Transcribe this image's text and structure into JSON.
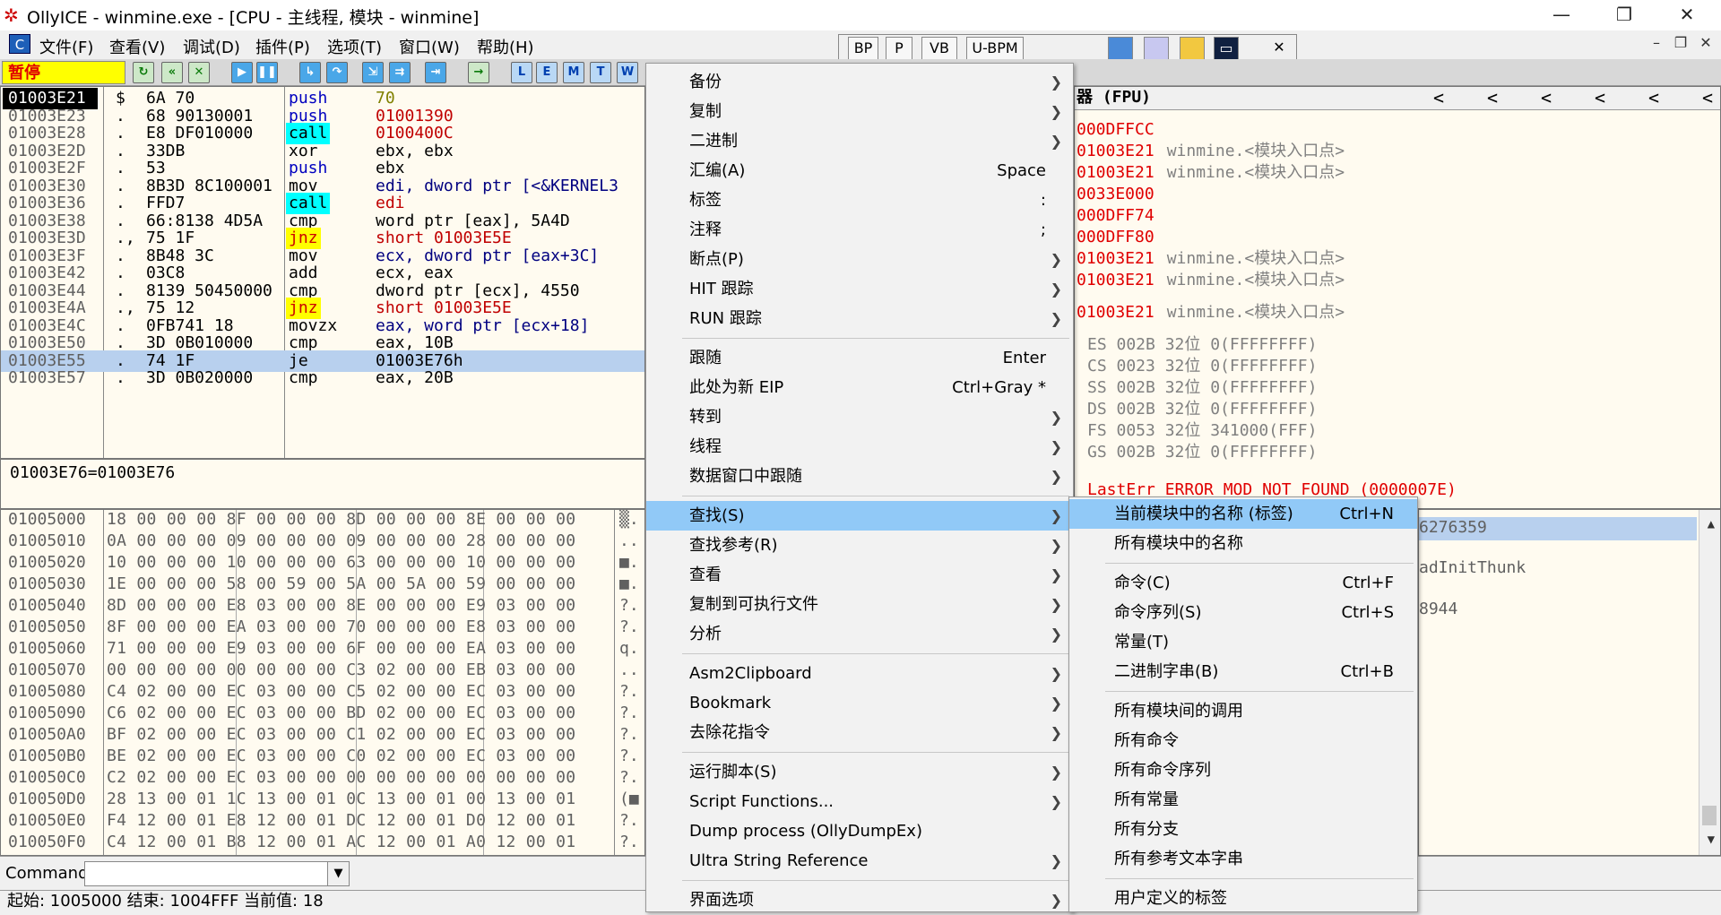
{
  "window": {
    "title": "OllyICE - winmine.exe - [CPU -  主线程, 模块 - winmine]"
  },
  "menubar": [
    "文件(F)",
    "查看(V)",
    "调试(D)",
    "插件(P)",
    "选项(T)",
    "窗口(W)",
    "帮助(H)"
  ],
  "toolbar_top": {
    "buttons": [
      "BP",
      "P",
      "VB",
      "U-BPM"
    ]
  },
  "toolbar": {
    "status": "暂停",
    "letters": [
      "L",
      "E",
      "M",
      "T",
      "W"
    ]
  },
  "disasm": {
    "rows": [
      {
        "addr": "01003E21",
        "flag": "$",
        "hex": "6A 70",
        "op": "push",
        "arg": "70"
      },
      {
        "addr": "01003E23",
        "flag": ".",
        "hex": "68 90130001",
        "op": "push",
        "arg": "01001390"
      },
      {
        "addr": "01003E28",
        "flag": ".",
        "hex": "E8 DF010000",
        "op": "call",
        "arg": "0100400C"
      },
      {
        "addr": "01003E2D",
        "flag": ".",
        "hex": "33DB",
        "op": "xor",
        "arg": "ebx, ebx"
      },
      {
        "addr": "01003E2F",
        "flag": ".",
        "hex": "53",
        "op": "push",
        "arg": "ebx"
      },
      {
        "addr": "01003E30",
        "flag": ".",
        "hex": "8B3D 8C100001",
        "op": "mov",
        "arg": "edi, dword ptr [<&KERNEL3"
      },
      {
        "addr": "01003E36",
        "flag": ".",
        "hex": "FFD7",
        "op": "call",
        "arg": "edi"
      },
      {
        "addr": "01003E38",
        "flag": ".",
        "hex": "66:8138 4D5A",
        "op": "cmp",
        "arg": "word ptr [eax], 5A4D"
      },
      {
        "addr": "01003E3D",
        "flag": ".,",
        "hex": "75 1F",
        "op": "jnz",
        "arg": "short 01003E5E"
      },
      {
        "addr": "01003E3F",
        "flag": ".",
        "hex": "8B48 3C",
        "op": "mov",
        "arg": "ecx, dword ptr [eax+3C]"
      },
      {
        "addr": "01003E42",
        "flag": ".",
        "hex": "03C8",
        "op": "add",
        "arg": "ecx, eax"
      },
      {
        "addr": "01003E44",
        "flag": ".",
        "hex": "8139 50450000",
        "op": "cmp",
        "arg": "dword ptr [ecx], 4550"
      },
      {
        "addr": "01003E4A",
        "flag": ".,",
        "hex": "75 12",
        "op": "jnz",
        "arg": "short 01003E5E"
      },
      {
        "addr": "01003E4C",
        "flag": ".",
        "hex": "0FB741 18",
        "op": "movzx",
        "arg": "eax, word ptr [ecx+18]"
      },
      {
        "addr": "01003E50",
        "flag": ".",
        "hex": "3D 0B010000",
        "op": "cmp",
        "arg": "eax, 10B"
      },
      {
        "addr": "01003E55",
        "flag": ".",
        "hex": "74 1F",
        "op": "je",
        "arg": "    01003E76h"
      },
      {
        "addr": "01003E57",
        "flag": ".",
        "hex": "3D 0B020000",
        "op": "cmp",
        "arg": "eax, 20B"
      }
    ]
  },
  "info": {
    "text": "01003E76=01003E76"
  },
  "registers": {
    "header": "器 (FPU)",
    "header_arrows": [
      "<",
      "<",
      "<",
      "<",
      "<",
      "<"
    ],
    "lines": [
      {
        "val": "000DFFCC",
        "note": ""
      },
      {
        "val": "01003E21",
        "note": "winmine.<模块入口点>"
      },
      {
        "val": "01003E21",
        "note": "winmine.<模块入口点>"
      },
      {
        "val": "0033E000",
        "note": ""
      },
      {
        "val": "000DFF74",
        "note": ""
      },
      {
        "val": "000DFF80",
        "note": ""
      },
      {
        "val": "01003E21",
        "note": "winmine.<模块入口点>"
      },
      {
        "val": "01003E21",
        "note": "winmine.<模块入口点>"
      },
      {
        "val": "01003E21",
        "note": "winmine.<模块入口点>"
      }
    ],
    "segments": [
      "ES 002B 32位 0(FFFFFFFF)",
      "CS 0023 32位 0(FFFFFFFF)",
      "SS 002B 32位 0(FFFFFFFF)",
      "DS 002B 32位 0(FFFFFFFF)",
      "FS 0053 32位 341000(FFF)",
      "GS 002B 32位 0(FFFFFFFF)"
    ],
    "lasterr": "LastErr ERROR_MOD_NOT_FOUND (0000007E)"
  },
  "dump": {
    "rows": [
      {
        "addr": "01005000",
        "hex": "18 00 00 00 8F 00 00 00 8D 00 00 00 8E 00 00 00",
        "asc": "▒."
      },
      {
        "addr": "01005010",
        "hex": "0A 00 00 00 09 00 00 00 09 00 00 00 28 00 00 00",
        "asc": ".."
      },
      {
        "addr": "01005020",
        "hex": "10 00 00 00 10 00 00 00 63 00 00 00 10 00 00 00",
        "asc": "■."
      },
      {
        "addr": "01005030",
        "hex": "1E 00 00 00 58 00 59 00 5A 00 5A 00 59 00 00 00",
        "asc": "■."
      },
      {
        "addr": "01005040",
        "hex": "8D 00 00 00 E8 03 00 00 8E 00 00 00 E9 03 00 00",
        "asc": "?."
      },
      {
        "addr": "01005050",
        "hex": "8F 00 00 00 EA 03 00 00 70 00 00 00 E8 03 00 00",
        "asc": "?."
      },
      {
        "addr": "01005060",
        "hex": "71 00 00 00 E9 03 00 00 6F 00 00 00 EA 03 00 00",
        "asc": "q."
      },
      {
        "addr": "01005070",
        "hex": "00 00 00 00 00 00 00 00 C3 02 00 00 EB 03 00 00",
        "asc": ".."
      },
      {
        "addr": "01005080",
        "hex": "C4 02 00 00 EC 03 00 00 C5 02 00 00 EC 03 00 00",
        "asc": "?."
      },
      {
        "addr": "01005090",
        "hex": "C6 02 00 00 EC 03 00 00 BD 02 00 00 EC 03 00 00",
        "asc": "?."
      },
      {
        "addr": "010050A0",
        "hex": "BF 02 00 00 EC 03 00 00 C1 02 00 00 EC 03 00 00",
        "asc": "?."
      },
      {
        "addr": "010050B0",
        "hex": "BE 02 00 00 EC 03 00 00 C0 02 00 00 EC 03 00 00",
        "asc": "?."
      },
      {
        "addr": "010050C0",
        "hex": "C2 02 00 00 EC 03 00 00 00 00 00 00 00 00 00 00",
        "asc": "?."
      },
      {
        "addr": "010050D0",
        "hex": "28 13 00 01 1C 13 00 01 0C 13 00 01 00 13 00 01",
        "asc": "(■"
      },
      {
        "addr": "010050E0",
        "hex": "F4 12 00 01 E8 12 00 01 DC 12 00 01 D0 12 00 01",
        "asc": "?."
      },
      {
        "addr": "010050F0",
        "hex": "C4 12 00 01 B8 12 00 01 AC 12 00 01 A0 12 00 01",
        "asc": "?."
      }
    ]
  },
  "stack": {
    "lines": [
      "6276359",
      "adInitThunk",
      "8944"
    ]
  },
  "context_menu": {
    "items": [
      {
        "label": "备份",
        "shortcut": "",
        "sub": true
      },
      {
        "label": "复制",
        "shortcut": "",
        "sub": true
      },
      {
        "label": "二进制",
        "shortcut": "",
        "sub": true
      },
      {
        "label": "汇编(A)",
        "shortcut": "Space",
        "sub": false
      },
      {
        "label": "标签",
        "shortcut": ":",
        "sub": false
      },
      {
        "label": "注释",
        "shortcut": ";",
        "sub": false
      },
      {
        "label": "断点(P)",
        "shortcut": "",
        "sub": true
      },
      {
        "label": "HIT 跟踪",
        "shortcut": "",
        "sub": true
      },
      {
        "label": "RUN 跟踪",
        "shortcut": "",
        "sub": true
      },
      {
        "label": "跟随",
        "shortcut": "Enter",
        "sub": false
      },
      {
        "label": "此处为新 EIP",
        "shortcut": "Ctrl+Gray *",
        "sub": false
      },
      {
        "label": "转到",
        "shortcut": "",
        "sub": true
      },
      {
        "label": "线程",
        "shortcut": "",
        "sub": true
      },
      {
        "label": "数据窗口中跟随",
        "shortcut": "",
        "sub": true
      },
      {
        "label": "查找(S)",
        "shortcut": "",
        "sub": true
      },
      {
        "label": "查找参考(R)",
        "shortcut": "",
        "sub": true
      },
      {
        "label": "查看",
        "shortcut": "",
        "sub": true
      },
      {
        "label": "复制到可执行文件",
        "shortcut": "",
        "sub": true
      },
      {
        "label": "分析",
        "shortcut": "",
        "sub": true
      },
      {
        "label": "Asm2Clipboard",
        "shortcut": "",
        "sub": true
      },
      {
        "label": "Bookmark",
        "shortcut": "",
        "sub": true
      },
      {
        "label": "去除花指令",
        "shortcut": "",
        "sub": true
      },
      {
        "label": "运行脚本(S)",
        "shortcut": "",
        "sub": true
      },
      {
        "label": "Script Functions...",
        "shortcut": "",
        "sub": true
      },
      {
        "label": "Dump process (OllyDumpEx)",
        "shortcut": "",
        "sub": false
      },
      {
        "label": "Ultra String Reference",
        "shortcut": "",
        "sub": true
      },
      {
        "label": "界面选项",
        "shortcut": "",
        "sub": true
      }
    ]
  },
  "submenu": {
    "items": [
      {
        "label": "当前模块中的名称 (标签)",
        "shortcut": "Ctrl+N"
      },
      {
        "label": "所有模块中的名称",
        "shortcut": ""
      },
      {
        "label": "命令(C)",
        "shortcut": "Ctrl+F"
      },
      {
        "label": "命令序列(S)",
        "shortcut": "Ctrl+S"
      },
      {
        "label": "常量(T)",
        "shortcut": ""
      },
      {
        "label": "二进制字串(B)",
        "shortcut": "Ctrl+B"
      },
      {
        "label": "所有模块间的调用",
        "shortcut": ""
      },
      {
        "label": "所有命令",
        "shortcut": ""
      },
      {
        "label": "所有命令序列",
        "shortcut": ""
      },
      {
        "label": "所有常量",
        "shortcut": ""
      },
      {
        "label": "所有分支",
        "shortcut": ""
      },
      {
        "label": "所有参考文本字串",
        "shortcut": ""
      },
      {
        "label": "用户定义的标签",
        "shortcut": ""
      }
    ]
  },
  "command": {
    "label": "Command",
    "value": ""
  },
  "status": {
    "text": "起始: 1005000  结束: 1004FFF  当前值: 18"
  },
  "colors": {
    "call_bg": "#00ffff",
    "jnz_bg": "#ffff00",
    "selection": "#b8d0ee",
    "menu_highlight": "#91c9f7",
    "error_red": "#e00000"
  }
}
